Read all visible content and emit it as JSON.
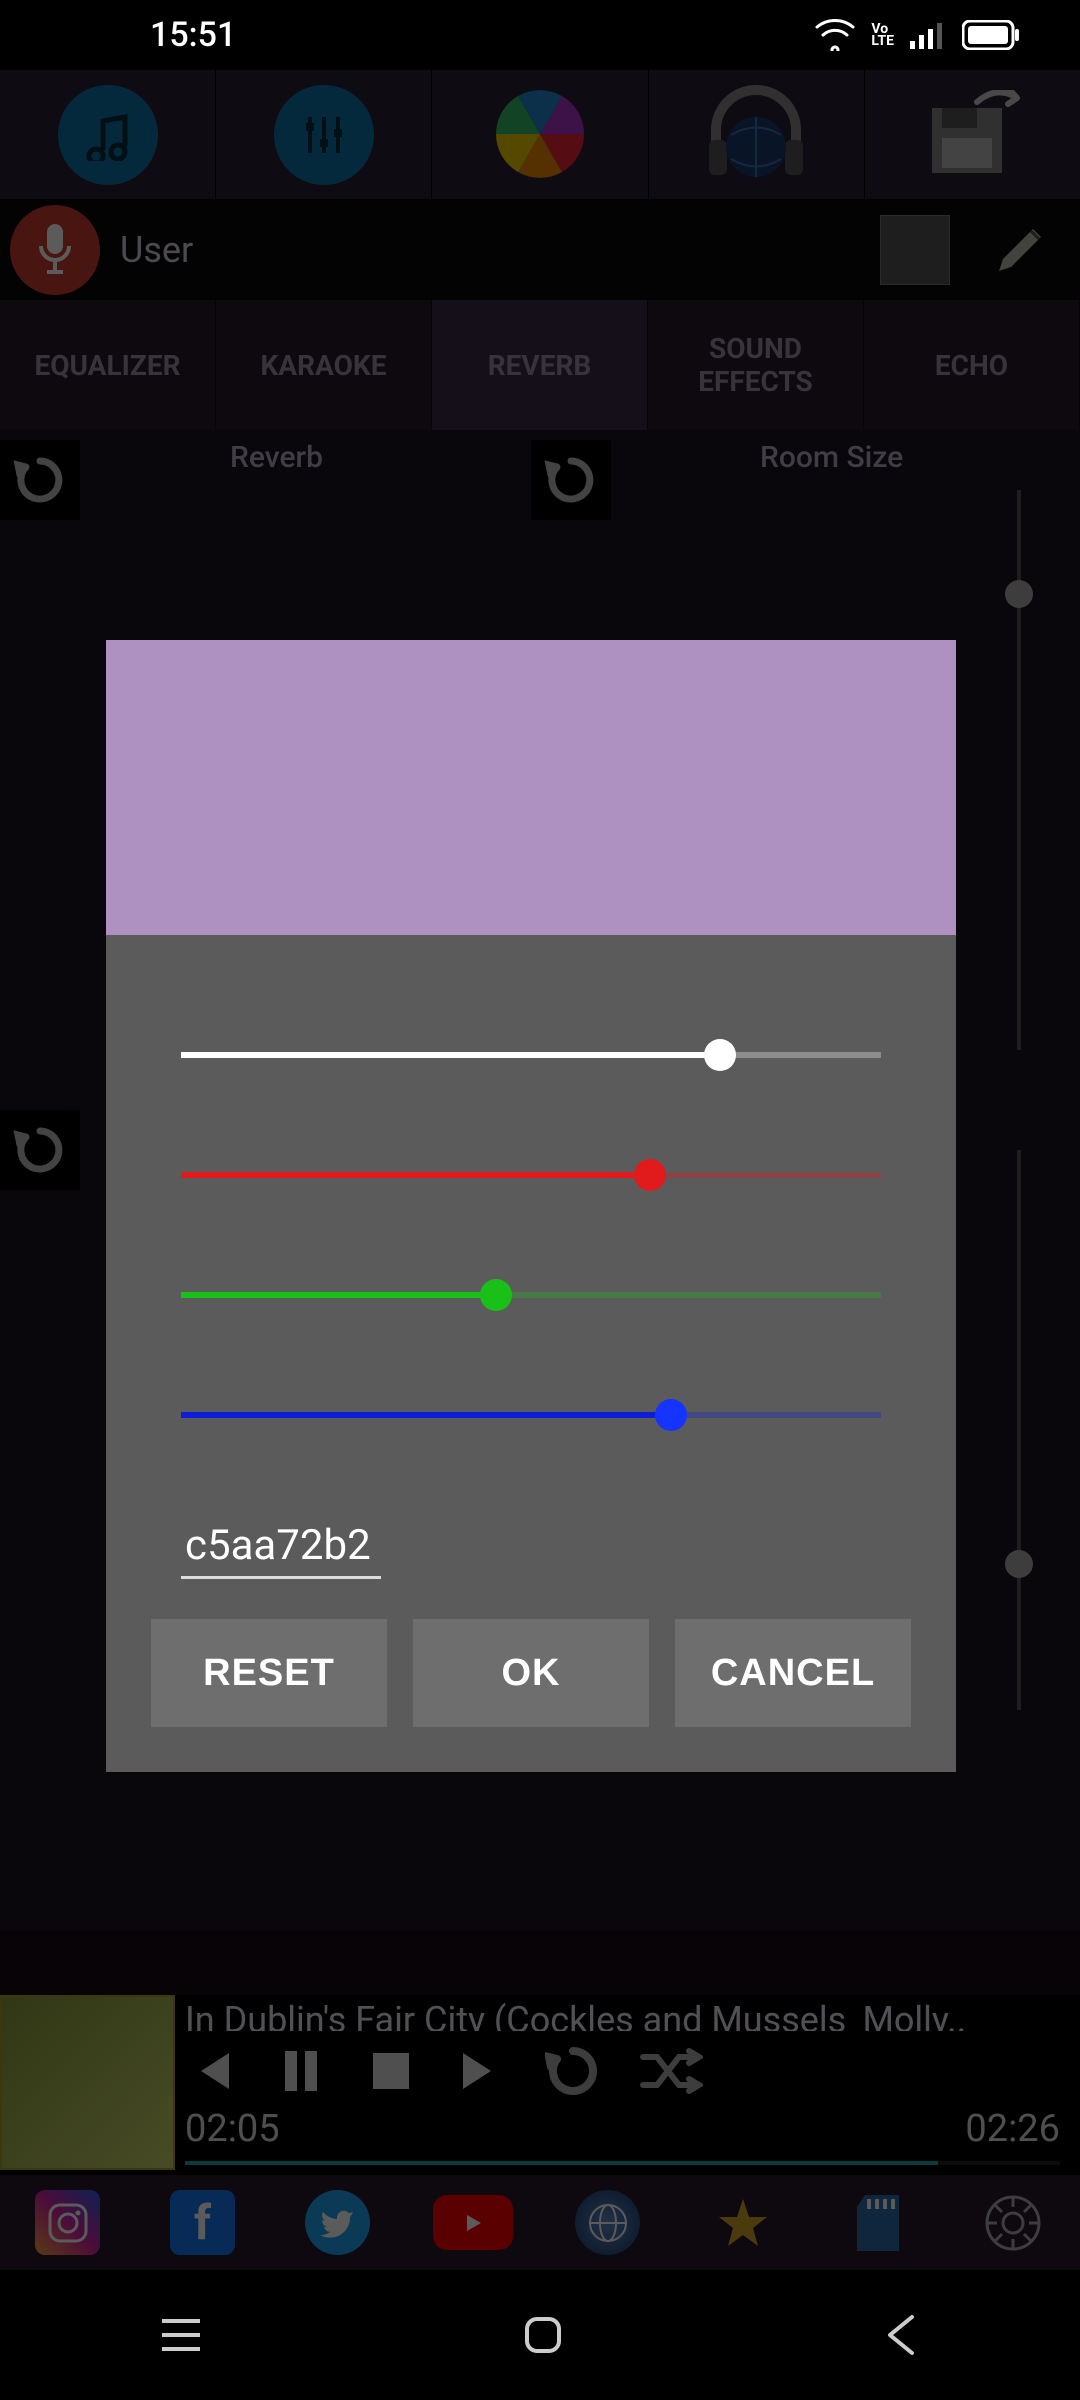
{
  "status": {
    "time": "15:51",
    "volte": "Vo\nLTE"
  },
  "user_row": {
    "label": "User"
  },
  "tabs": [
    {
      "label": "EQUALIZER"
    },
    {
      "label": "KARAOKE"
    },
    {
      "label": "REVERB"
    },
    {
      "label": "SOUND EFFECTS"
    },
    {
      "label": "ECHO"
    }
  ],
  "reverb": {
    "label_left": "Reverb",
    "label_right": "Room Size"
  },
  "player": {
    "title": "In Dublin's Fair City (Cockles and Mussels_Molly..",
    "elapsed": "02:05",
    "total": "02:26",
    "progress_pct": 86
  },
  "modal": {
    "header_color": "#ae90c1",
    "sliders": {
      "alpha": {
        "value": 77,
        "color_fill": "#ffffff",
        "color_thumb": "#ffffff"
      },
      "red": {
        "value": 67,
        "color_fill": "#e11b1b",
        "color_thumb": "#e11b1b"
      },
      "green": {
        "value": 45,
        "color_fill": "#18c018",
        "color_thumb": "#18c018"
      },
      "blue": {
        "value": 70,
        "color_fill": "#0a1fd6",
        "color_thumb": "#1534ff"
      }
    },
    "hex": "c5aa72b2",
    "buttons": {
      "reset": "RESET",
      "ok": "OK",
      "cancel": "CANCEL"
    }
  }
}
